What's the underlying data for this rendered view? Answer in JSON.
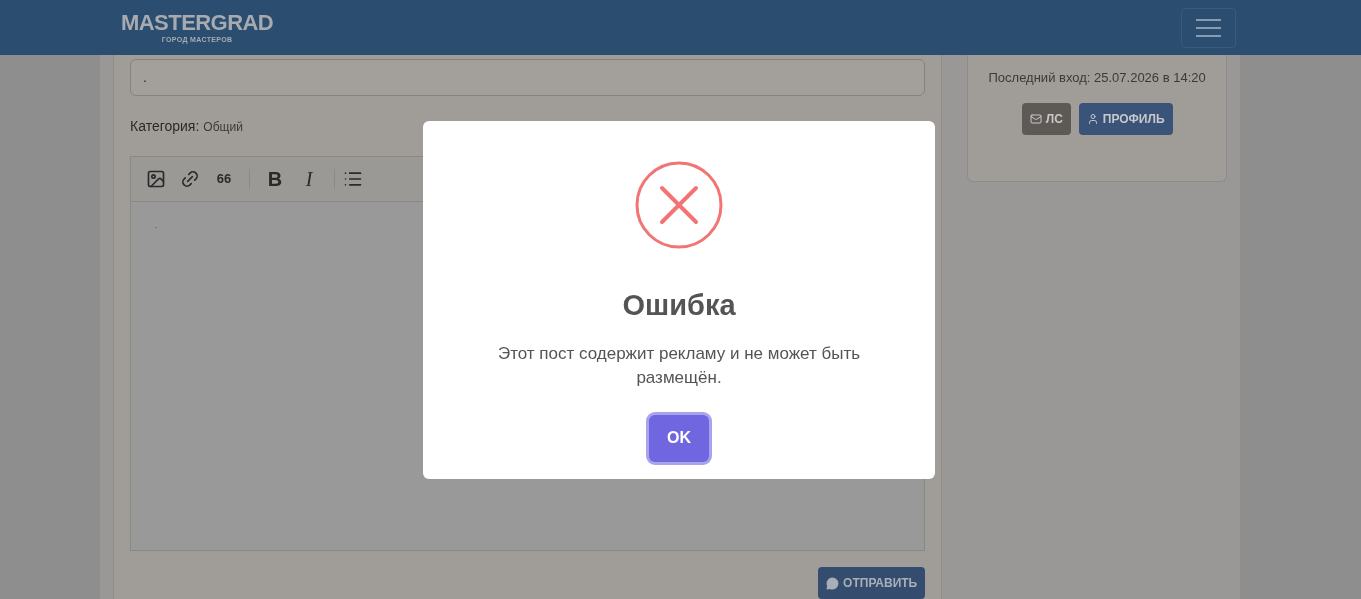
{
  "header": {
    "logo": "MASTERGRAD",
    "logo_tagline": "ГОРОД МАСТЕРОВ"
  },
  "post_form": {
    "title_value": ".",
    "category_label": "Категория:",
    "category_value": "Общий",
    "body_value": ".",
    "submit_button": "ОТПРАВИТЬ"
  },
  "toolbar": [
    {
      "kind": "image"
    },
    {
      "kind": "link"
    },
    {
      "kind": "quote",
      "text": "66"
    },
    {
      "kind": "separator"
    },
    {
      "kind": "bold",
      "text": "B"
    },
    {
      "kind": "italic",
      "text": "I"
    },
    {
      "kind": "separator"
    },
    {
      "kind": "list"
    }
  ],
  "user_card": {
    "last_login": "Последний вход: 25.07.2026 в 14:20",
    "buttons": [
      {
        "kind": "message",
        "label": "ЛС"
      },
      {
        "kind": "profile",
        "label": "ПРОФИЛЬ"
      }
    ]
  },
  "dialog": {
    "title": "Ошибка",
    "message": "Этот пост содержит рекламу и не может быть размещён.",
    "button": "OK"
  }
}
